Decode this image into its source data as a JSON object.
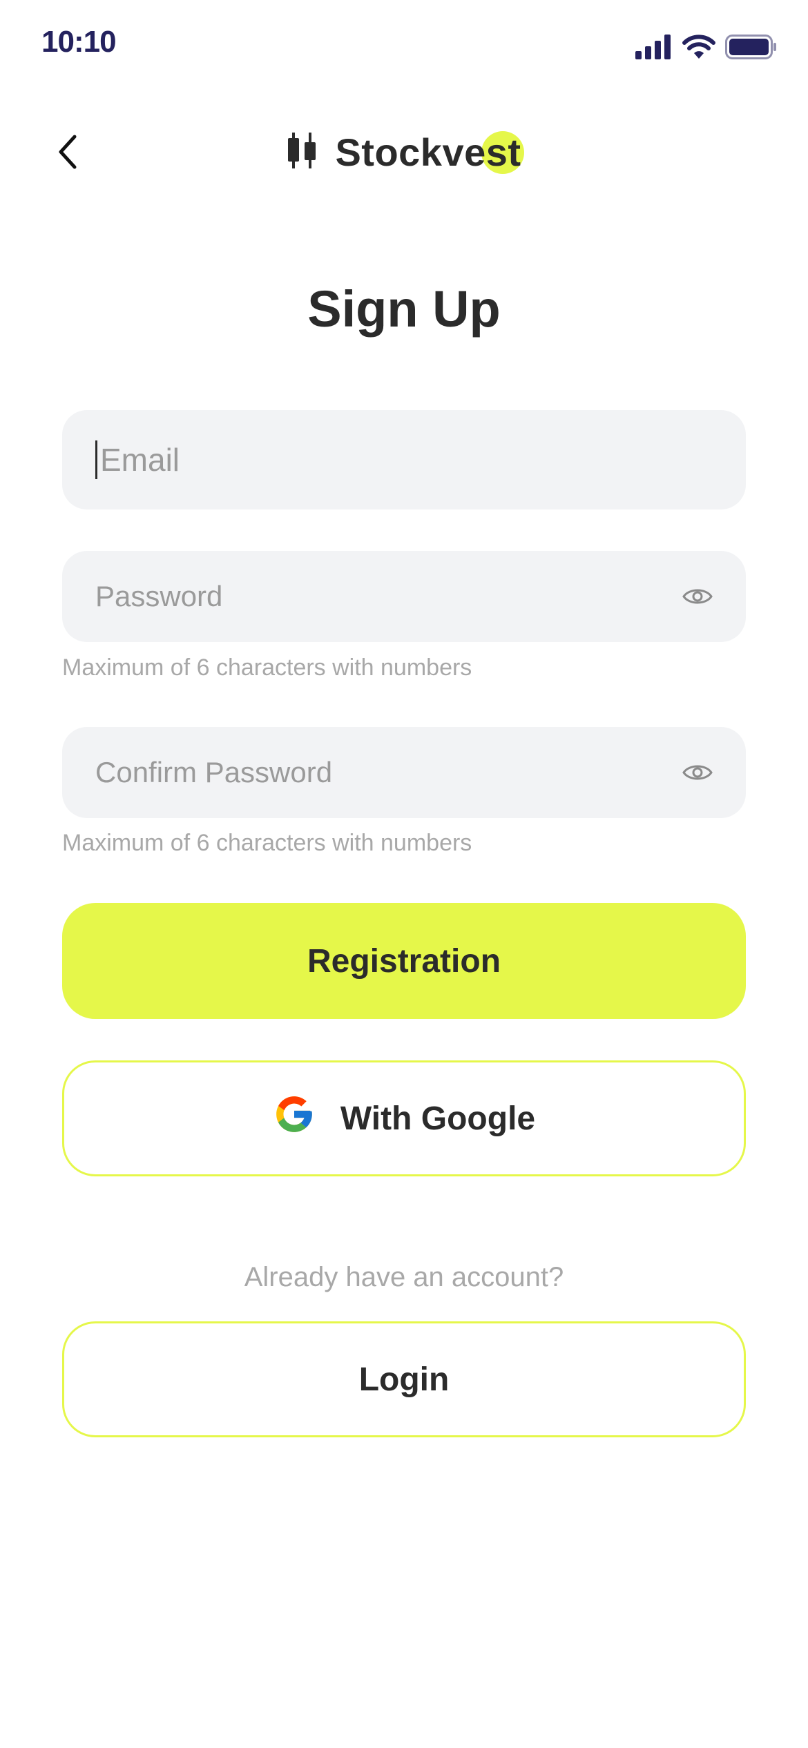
{
  "status_bar": {
    "time": "10:10",
    "icons": [
      "cellular-signal-icon",
      "wifi-icon",
      "battery-icon"
    ]
  },
  "header": {
    "back_icon": "chevron-left-icon",
    "logo_icon": "candlestick-icon",
    "brand_name": "Stockvest"
  },
  "page_title": "Sign Up",
  "form": {
    "email": {
      "placeholder": "Email",
      "value": ""
    },
    "password": {
      "placeholder": "Password",
      "value": "",
      "hint": "Maximum of 6 characters with numbers",
      "icon": "eye-icon"
    },
    "confirm_password": {
      "placeholder": "Confirm Password",
      "value": "",
      "hint": "Maximum of 6 characters with numbers",
      "icon": "eye-icon"
    }
  },
  "buttons": {
    "registration": "Registration",
    "google": "With Google",
    "login": "Login"
  },
  "already_text": "Already have an account?",
  "colors": {
    "accent": "#E5F74A",
    "text": "#2B2B2B",
    "field_bg": "#F2F3F5",
    "muted": "#A8A8A8",
    "status_text": "#24225E"
  }
}
